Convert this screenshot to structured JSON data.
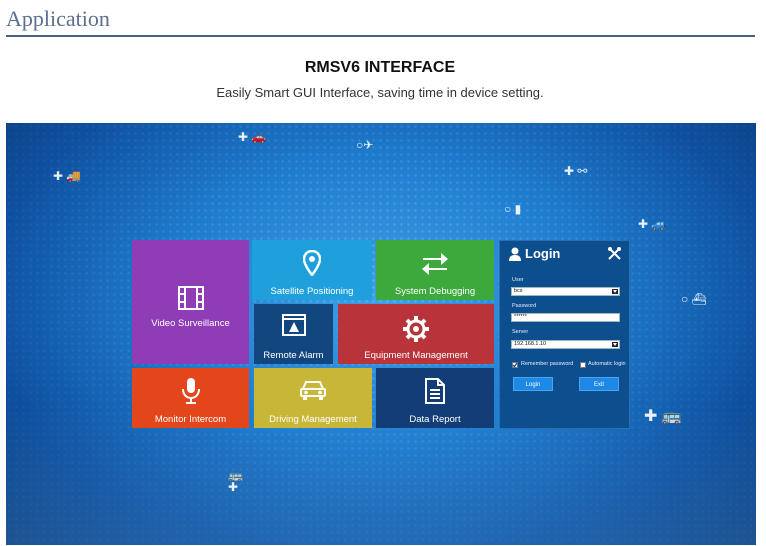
{
  "page": {
    "heading": "Application",
    "title": "RMSV6 INTERFACE",
    "subtitle": "Easily Smart GUI Interface, saving time in device setting."
  },
  "tiles": {
    "video_surveillance": "Video Surveillance",
    "satellite_positioning": "Satellite Positioning",
    "system_debugging": "System Debugging",
    "remote_alarm": "Remote Alarm",
    "equipment_management": "Equipment Management",
    "monitor_intercom": "Monitor Intercom",
    "driving_management": "Driving Management",
    "data_report": "Data Report"
  },
  "login": {
    "title": "Login",
    "user_label": "User",
    "user_value": "bcs",
    "password_label": "Password",
    "password_value": "******",
    "server_label": "Server",
    "server_value": "192.168.1.10",
    "remember_label": "Remember password",
    "remember_checked": true,
    "auto_login_label": "Automatic login",
    "auto_login_checked": false,
    "login_button": "Login",
    "exit_button": "Exit"
  },
  "colors": {
    "video_surveillance": "#8e3db6",
    "satellite_positioning": "#1fa0dc",
    "system_debugging": "#3da93d",
    "remote_alarm": "#12467f",
    "equipment_management": "#b9343a",
    "monitor_intercom": "#e4461c",
    "driving_management": "#c8b638",
    "data_report": "#123d76",
    "login_panel": "#0d4e8f",
    "heading": "#5b6f8f"
  },
  "icons": [
    "film-icon",
    "map-pin-icon",
    "swap-arrows-icon",
    "alarm-window-icon",
    "gear-icon",
    "microphone-icon",
    "car-icon",
    "document-icon",
    "user-icon",
    "tools-icon"
  ]
}
